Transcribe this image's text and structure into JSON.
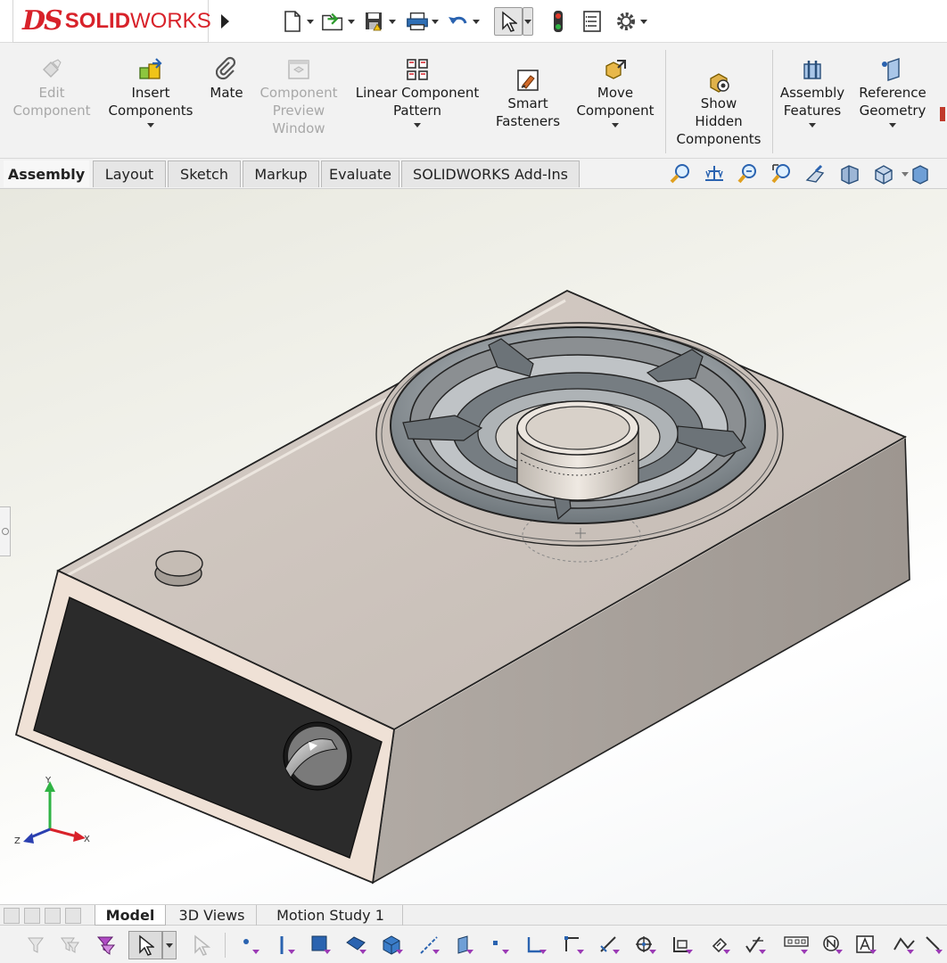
{
  "app": {
    "logo_mark": "DS",
    "logo_solid": "SOLID",
    "logo_works": "WORKS",
    "brand_color": "#d8222a"
  },
  "quick_access": {
    "items": [
      "new-document-icon",
      "open-icon",
      "save-icon",
      "print-icon",
      "undo-icon",
      "select-arrow-icon",
      "rebuild-traffic-light-icon",
      "file-properties-icon",
      "options-gear-icon"
    ]
  },
  "ribbon": {
    "buttons": [
      {
        "id": "edit-component",
        "label": "Edit\nComponent",
        "enabled": false
      },
      {
        "id": "insert-components",
        "label": "Insert\nComponents",
        "enabled": true
      },
      {
        "id": "mate",
        "label": "Mate",
        "enabled": true
      },
      {
        "id": "component-preview-window",
        "label": "Component\nPreview\nWindow",
        "enabled": false
      },
      {
        "id": "linear-component-pattern",
        "label": "Linear Component\nPattern",
        "enabled": true
      },
      {
        "id": "smart-fasteners",
        "label": "Smart\nFasteners",
        "enabled": true
      },
      {
        "id": "move-component",
        "label": "Move\nComponent",
        "enabled": true
      },
      {
        "id": "show-hidden-components",
        "label": "Show\nHidden\nComponents",
        "enabled": true
      },
      {
        "id": "assembly-features",
        "label": "Assembly\nFeatures",
        "enabled": true
      },
      {
        "id": "reference-geometry",
        "label": "Reference\nGeometry",
        "enabled": true
      }
    ]
  },
  "tabs": {
    "items": [
      "Assembly",
      "Layout",
      "Sketch",
      "Markup",
      "Evaluate",
      "SOLIDWORKS Add-Ins"
    ],
    "active": "Assembly"
  },
  "view_tools": [
    "zoom-to-fit-icon",
    "zoom-to-area-icon",
    "previous-view-icon",
    "section-view-icon",
    "view-orientation-icon",
    "display-style-icon",
    "hide-show-items-icon",
    "appearance-icon"
  ],
  "triad": {
    "x": "X",
    "y": "Y",
    "z": "Z"
  },
  "bottom_tabs": {
    "items": [
      "Model",
      "3D Views",
      "Motion Study 1"
    ],
    "active": "Model"
  },
  "colors": {
    "body_fill": "#c9c0b9",
    "body_side": "#a7a09a",
    "panel_fill": "#2b2b2b",
    "grate": "#8e969c",
    "viewport_bg": "#f4f4ee"
  }
}
